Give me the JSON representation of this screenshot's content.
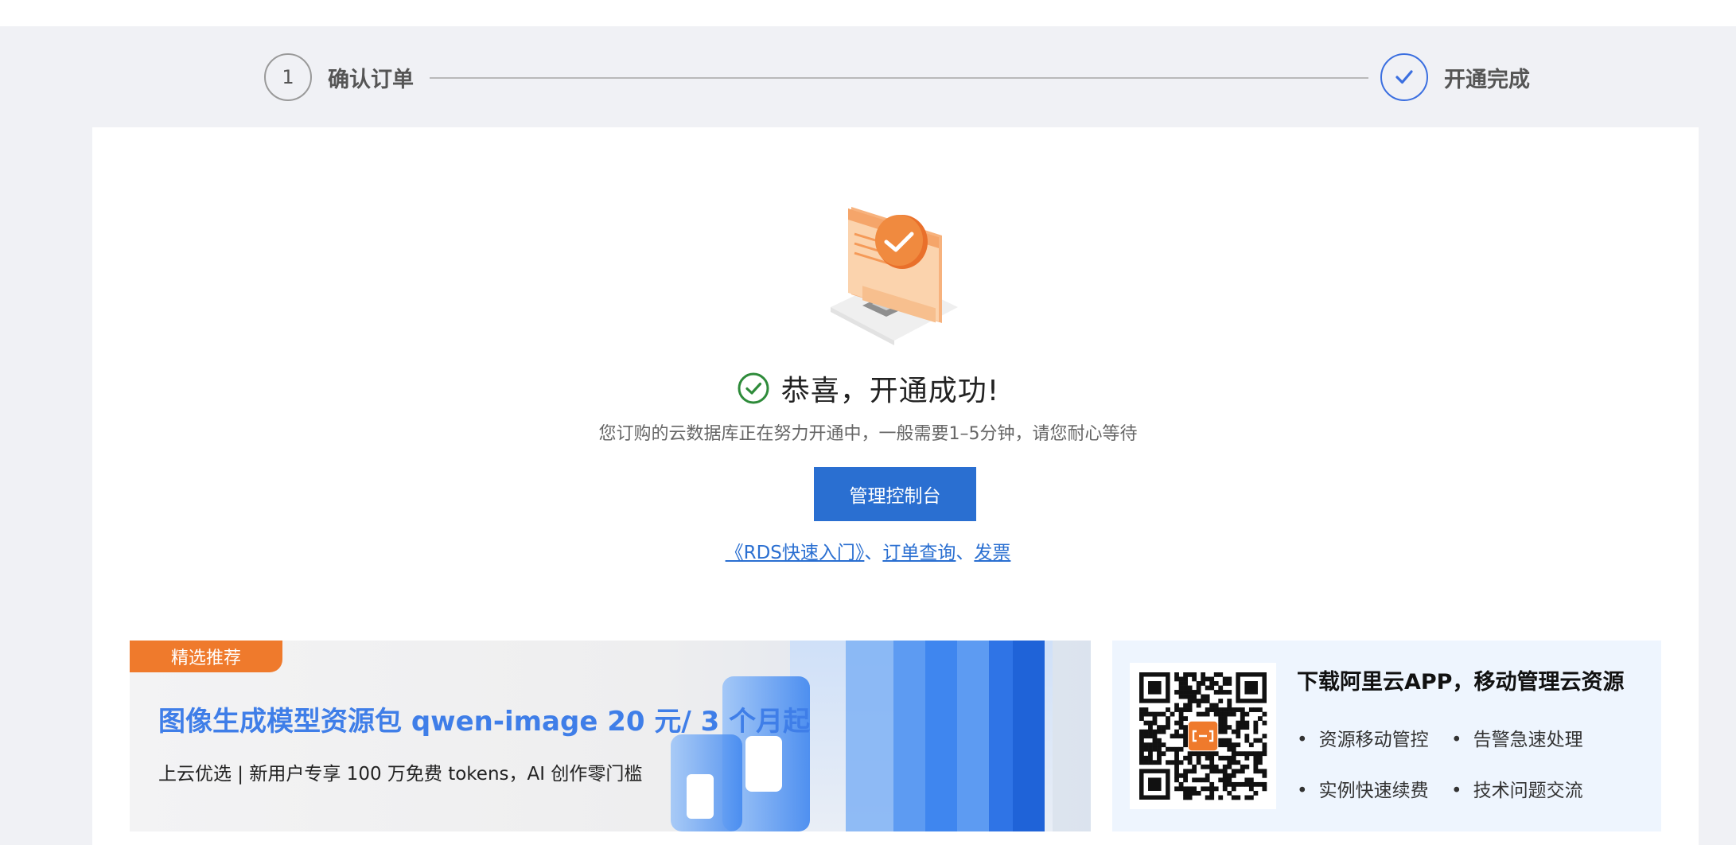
{
  "steps": [
    {
      "number": "1",
      "label": "确认订单"
    },
    {
      "label": "开通完成"
    }
  ],
  "result": {
    "title": "恭喜，开通成功!",
    "subtitle": "您订购的云数据库正在努力开通中，一般需要1–5分钟，请您耐心等待",
    "button_label": "管理控制台",
    "links": [
      "《RDS快速入门》",
      "订单查询",
      "发票"
    ],
    "separator": "、"
  },
  "promo": {
    "tag": "精选推荐",
    "title": "图像生成模型资源包 qwen-image 20 元/ 3 个月起",
    "subtitle": "上云优选 | 新用户专享 100 万免费 tokens，AI 创作零门槛"
  },
  "app_download": {
    "title": "下载阿里云APP，移动管理云资源",
    "features": [
      "资源移动管控",
      "告警急速处理",
      "实例快速续费",
      "技术问题交流"
    ]
  },
  "colors": {
    "accent": "#2a6fd1",
    "success": "#2e8b3a",
    "promo_tag": "#ef7a2c",
    "promo_title": "#3f7ee8"
  },
  "icons": {
    "step_done": "check-icon",
    "success": "check-circle-icon",
    "illustration": "monitor-success-illustration",
    "qr": "qr-code-icon"
  }
}
